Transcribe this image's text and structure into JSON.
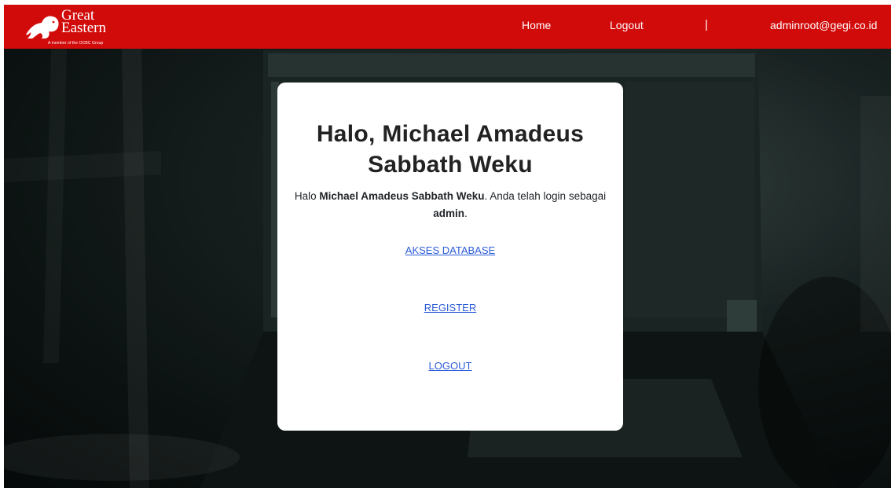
{
  "header": {
    "brand_line1": "Great",
    "brand_line2": "Eastern",
    "tagline": "A member of the OCBC Group",
    "nav": {
      "home": "Home",
      "logout": "Logout",
      "separator": "|",
      "user_email": "adminroot@gegi.co.id"
    },
    "color": "#d10a0a"
  },
  "card": {
    "title": "Halo, Michael Amadeus Sabbath Weku",
    "greeting_prefix": "Halo",
    "user_name": "Michael Amadeus Sabbath Weku",
    "greeting_middle": ". Anda telah login sebagai",
    "role": "admin",
    "greeting_suffix": ".",
    "links": {
      "database": "AKSES DATABASE",
      "register": "REGISTER",
      "logout": "LOGOUT"
    },
    "link_color": "#2b5bd7"
  }
}
